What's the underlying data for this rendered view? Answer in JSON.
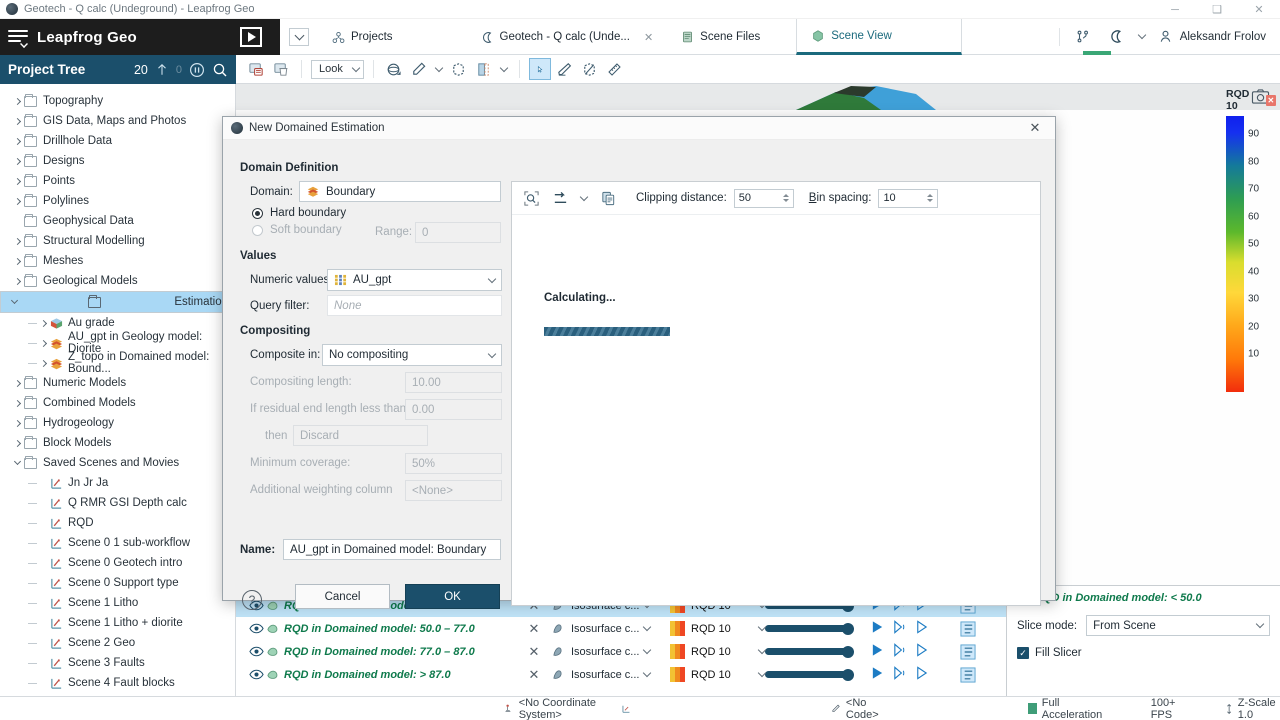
{
  "window": {
    "title": "Geotech - Q calc (Undeground) - Leapfrog Geo",
    "minimize": "─",
    "maximize": "❑",
    "close": "✕"
  },
  "header": {
    "brand": "Leapfrog Geo",
    "play_label": "play-button"
  },
  "tabs": [
    {
      "label": "Projects",
      "icon": "projects-icon",
      "active": false,
      "closable": false
    },
    {
      "label": "Geotech - Q calc (Unde...",
      "icon": "project-icon",
      "active": false,
      "closable": true
    },
    {
      "label": "Scene Files",
      "icon": "scene-files-icon",
      "active": false,
      "closable": false
    },
    {
      "label": "Scene View",
      "icon": "scene-view-icon",
      "active": true,
      "closable": false
    }
  ],
  "user": {
    "name": "Aleksandr Frolov"
  },
  "project_tree": {
    "title": "Project Tree",
    "counter": "20",
    "counter_secondary": "0",
    "items": [
      {
        "label": "Topography",
        "level": 0,
        "expandable": true,
        "expanded": false,
        "icon": "folder-icon"
      },
      {
        "label": "GIS Data, Maps and Photos",
        "level": 0,
        "expandable": true,
        "expanded": false,
        "icon": "folder-icon"
      },
      {
        "label": "Drillhole Data",
        "level": 0,
        "expandable": true,
        "expanded": false,
        "icon": "folder-icon"
      },
      {
        "label": "Designs",
        "level": 0,
        "expandable": true,
        "expanded": false,
        "icon": "folder-icon"
      },
      {
        "label": "Points",
        "level": 0,
        "expandable": true,
        "expanded": false,
        "icon": "folder-icon"
      },
      {
        "label": "Polylines",
        "level": 0,
        "expandable": true,
        "expanded": false,
        "icon": "folder-icon"
      },
      {
        "label": "Geophysical Data",
        "level": 0,
        "expandable": false,
        "expanded": false,
        "icon": "folder-icon"
      },
      {
        "label": "Structural Modelling",
        "level": 0,
        "expandable": true,
        "expanded": false,
        "icon": "folder-icon"
      },
      {
        "label": "Meshes",
        "level": 0,
        "expandable": true,
        "expanded": false,
        "icon": "folder-icon"
      },
      {
        "label": "Geological Models",
        "level": 0,
        "expandable": true,
        "expanded": false,
        "icon": "folder-icon"
      },
      {
        "label": "Estimation",
        "level": 0,
        "expandable": true,
        "expanded": true,
        "icon": "folder-icon",
        "selected": true
      },
      {
        "label": "Au grade",
        "level": 1,
        "expandable": true,
        "expanded": false,
        "icon": "cube-icon"
      },
      {
        "label": "AU_gpt in Geology model: Diorite",
        "level": 1,
        "expandable": true,
        "expanded": false,
        "icon": "stack-icon"
      },
      {
        "label": "Z_topo in Domained model: Bound...",
        "level": 1,
        "expandable": true,
        "expanded": false,
        "icon": "stack-icon"
      },
      {
        "label": "Numeric Models",
        "level": 0,
        "expandable": true,
        "expanded": false,
        "icon": "folder-icon"
      },
      {
        "label": "Combined Models",
        "level": 0,
        "expandable": true,
        "expanded": false,
        "icon": "folder-icon"
      },
      {
        "label": "Hydrogeology",
        "level": 0,
        "expandable": true,
        "expanded": false,
        "icon": "folder-icon"
      },
      {
        "label": "Block Models",
        "level": 0,
        "expandable": true,
        "expanded": false,
        "icon": "folder-icon"
      },
      {
        "label": "Saved Scenes and Movies",
        "level": 0,
        "expandable": true,
        "expanded": true,
        "icon": "folder-icon"
      },
      {
        "label": "Jn Jr Ja",
        "level": 1,
        "expandable": false,
        "expanded": false,
        "icon": "scene-icon"
      },
      {
        "label": "Q RMR GSI Depth calc",
        "level": 1,
        "expandable": false,
        "expanded": false,
        "icon": "scene-icon"
      },
      {
        "label": "RQD",
        "level": 1,
        "expandable": false,
        "expanded": false,
        "icon": "scene-icon"
      },
      {
        "label": "Scene 0 1 sub-workflow",
        "level": 1,
        "expandable": false,
        "expanded": false,
        "icon": "scene-icon"
      },
      {
        "label": "Scene 0 Geotech intro",
        "level": 1,
        "expandable": false,
        "expanded": false,
        "icon": "scene-icon"
      },
      {
        "label": "Scene 0 Support type",
        "level": 1,
        "expandable": false,
        "expanded": false,
        "icon": "scene-icon"
      },
      {
        "label": "Scene 1 Litho",
        "level": 1,
        "expandable": false,
        "expanded": false,
        "icon": "scene-icon"
      },
      {
        "label": "Scene 1 Litho + diorite",
        "level": 1,
        "expandable": false,
        "expanded": false,
        "icon": "scene-icon"
      },
      {
        "label": "Scene 2 Geo",
        "level": 1,
        "expandable": false,
        "expanded": false,
        "icon": "scene-icon"
      },
      {
        "label": "Scene 3 Faults",
        "level": 1,
        "expandable": false,
        "expanded": false,
        "icon": "scene-icon"
      },
      {
        "label": "Scene 4 Fault blocks",
        "level": 1,
        "expandable": false,
        "expanded": false,
        "icon": "scene-icon"
      }
    ]
  },
  "scene_toolbar": {
    "look_label": "Look",
    "buttons": [
      "save-scene-icon",
      "delete-scene-icon",
      "orbit-icon",
      "draw-icon",
      "clipping-icon",
      "slicer-icon",
      "select-icon",
      "pen-icon",
      "plane-icon",
      "ruler-icon"
    ]
  },
  "legend": {
    "title": "RQD 10",
    "close": "✕",
    "ticks": [
      "90",
      "80",
      "70",
      "60",
      "50",
      "40",
      "30",
      "20",
      "10"
    ]
  },
  "shape_list": {
    "rows": [
      {
        "name": "RQD in Domained model: < 50.0",
        "type": "Isosurface c...",
        "colormap": "RQD 10",
        "highlight": true
      },
      {
        "name": "RQD in Domained model: 50.0 – 77.0",
        "type": "Isosurface c...",
        "colormap": "RQD 10",
        "highlight": false
      },
      {
        "name": "RQD in Domained model: 77.0 – 87.0",
        "type": "Isosurface c...",
        "colormap": "RQD 10",
        "highlight": false
      },
      {
        "name": "RQD in Domained model: > 87.0",
        "type": "Isosurface c...",
        "colormap": "RQD 10",
        "highlight": false
      }
    ]
  },
  "properties_panel": {
    "title": "RQD in Domained model: < 50.0",
    "slice_mode_label": "Slice mode:",
    "slice_mode_value": "From Scene",
    "fill_slicer_label": "Fill Slicer",
    "fill_slicer_checked": true
  },
  "status_bar": {
    "coordinate_system": "<No Coordinate System>",
    "code": "<No Code>",
    "acceleration": "Full Acceleration",
    "fps": "100+ FPS",
    "z_scale": "Z-Scale 1.0"
  },
  "dialog": {
    "title": "New Domained Estimation",
    "close": "✕",
    "domain_definition_heading": "Domain Definition",
    "domain_label": "Domain:",
    "domain_value": "Boundary",
    "hard_boundary_label": "Hard boundary",
    "soft_boundary_label": "Soft boundary",
    "boundary_selected": "hard",
    "range_label": "Range:",
    "range_value": "0",
    "values_heading": "Values",
    "numeric_values_label": "Numeric values:",
    "numeric_values_value": "AU_gpt",
    "query_filter_label": "Query filter:",
    "query_filter_value": "None",
    "compositing_heading": "Compositing",
    "composite_in_label": "Composite in:",
    "composite_in_value": "No compositing",
    "compositing_length_label": "Compositing length:",
    "compositing_length_value": "10.00",
    "residual_label": "If residual end length less than:",
    "residual_value": "0.00",
    "then_label": "then",
    "then_value": "Discard",
    "minimum_coverage_label": "Minimum coverage:",
    "minimum_coverage_value": "50%",
    "additional_weighting_label": "Additional weighting column",
    "additional_weighting_value": "<None>",
    "name_label": "Name:",
    "name_value": "AU_gpt in Domained model: Boundary",
    "cancel_label": "Cancel",
    "ok_label": "OK",
    "help_label": "?",
    "preview": {
      "clipping_distance_label": "Clipping distance:",
      "clipping_distance_value": "50",
      "bin_spacing_label": "Bin spacing:",
      "bin_spacing_value": "10",
      "status_text": "Calculating..."
    }
  }
}
